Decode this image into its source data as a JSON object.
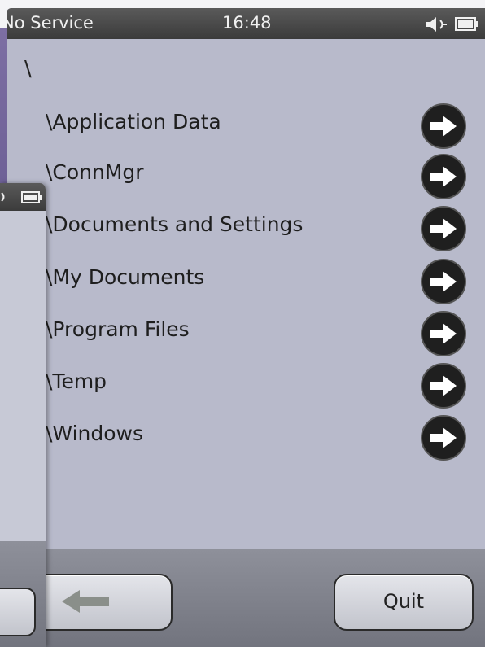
{
  "status_bar": {
    "carrier": "No Service",
    "time": "16:48"
  },
  "icons": {
    "speaker": "speaker-icon",
    "battery": "battery-icon",
    "row_arrow": "arrow-right-circle-icon",
    "back": "arrow-left-icon"
  },
  "browser": {
    "current_path": "\\",
    "folders": [
      {
        "label": "\\Application Data"
      },
      {
        "label": "\\ConnMgr"
      },
      {
        "label": "\\Documents and Settings"
      },
      {
        "label": "\\My Documents"
      },
      {
        "label": "\\Program Files"
      },
      {
        "label": "\\Temp"
      },
      {
        "label": "\\Windows"
      }
    ]
  },
  "footer": {
    "quit_label": "Quit"
  },
  "colors": {
    "screen_bg": "#b8bacb",
    "status_bg": "#3b3b3b",
    "arrow_bg": "#1f1f1f",
    "arrow_fg": "#ffffff",
    "back_arrow": "#8a8f8a"
  }
}
